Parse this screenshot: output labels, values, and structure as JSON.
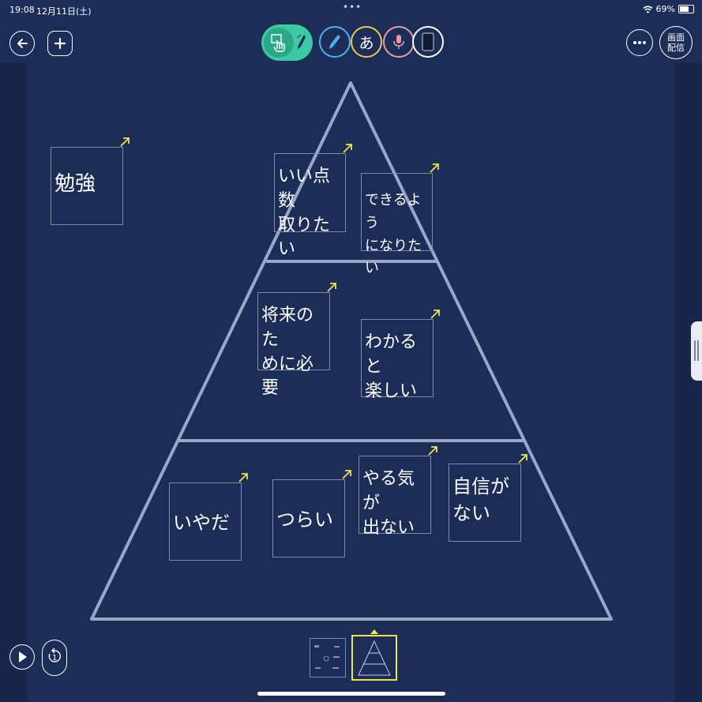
{
  "status_bar": {
    "time": "19:08",
    "date": "12月11日(土)",
    "dots": "•••",
    "battery_percent": "69%",
    "battery_level": 0.69
  },
  "toolbar": {
    "back_icon": "arrow-left-icon",
    "add_icon": "plus-icon",
    "text_tool_label": "あ",
    "more_icon": "ellipsis-icon",
    "share_label_line1": "画面",
    "share_label_line2": "配信"
  },
  "colors": {
    "background": "#1c2d57",
    "triangle": "#9aa7c8",
    "accent_green": "#3ec9a5",
    "pen_blue": "#4ab3ee",
    "text_yellow": "#e8c65a",
    "mic_pink": "#e79aa8",
    "arrow_yellow": "#f0e34a",
    "selected_thumb": "#f0e34a"
  },
  "cards": {
    "benkyou": {
      "line1": "勉強",
      "line2": ""
    },
    "iitensuu": {
      "line1": "いい点数",
      "line2": "取りたい"
    },
    "dekiru": {
      "line1": "できるよう",
      "line2": "になりたい"
    },
    "shourai": {
      "line1": "将来のた",
      "line2": "めに必要"
    },
    "wakaru": {
      "line1": "わかると",
      "line2": "楽しい"
    },
    "iyada": {
      "line1": "いやだ",
      "line2": ""
    },
    "tsurai": {
      "line1": "つらい",
      "line2": ""
    },
    "yaruki": {
      "line1": "やる気が",
      "line2": "出ない"
    },
    "jishin": {
      "line1": "自信が",
      "line2": "ない"
    }
  },
  "bottom": {
    "play_icon": "play-icon",
    "history_icon": "rewind-icon",
    "history_count": "1"
  }
}
